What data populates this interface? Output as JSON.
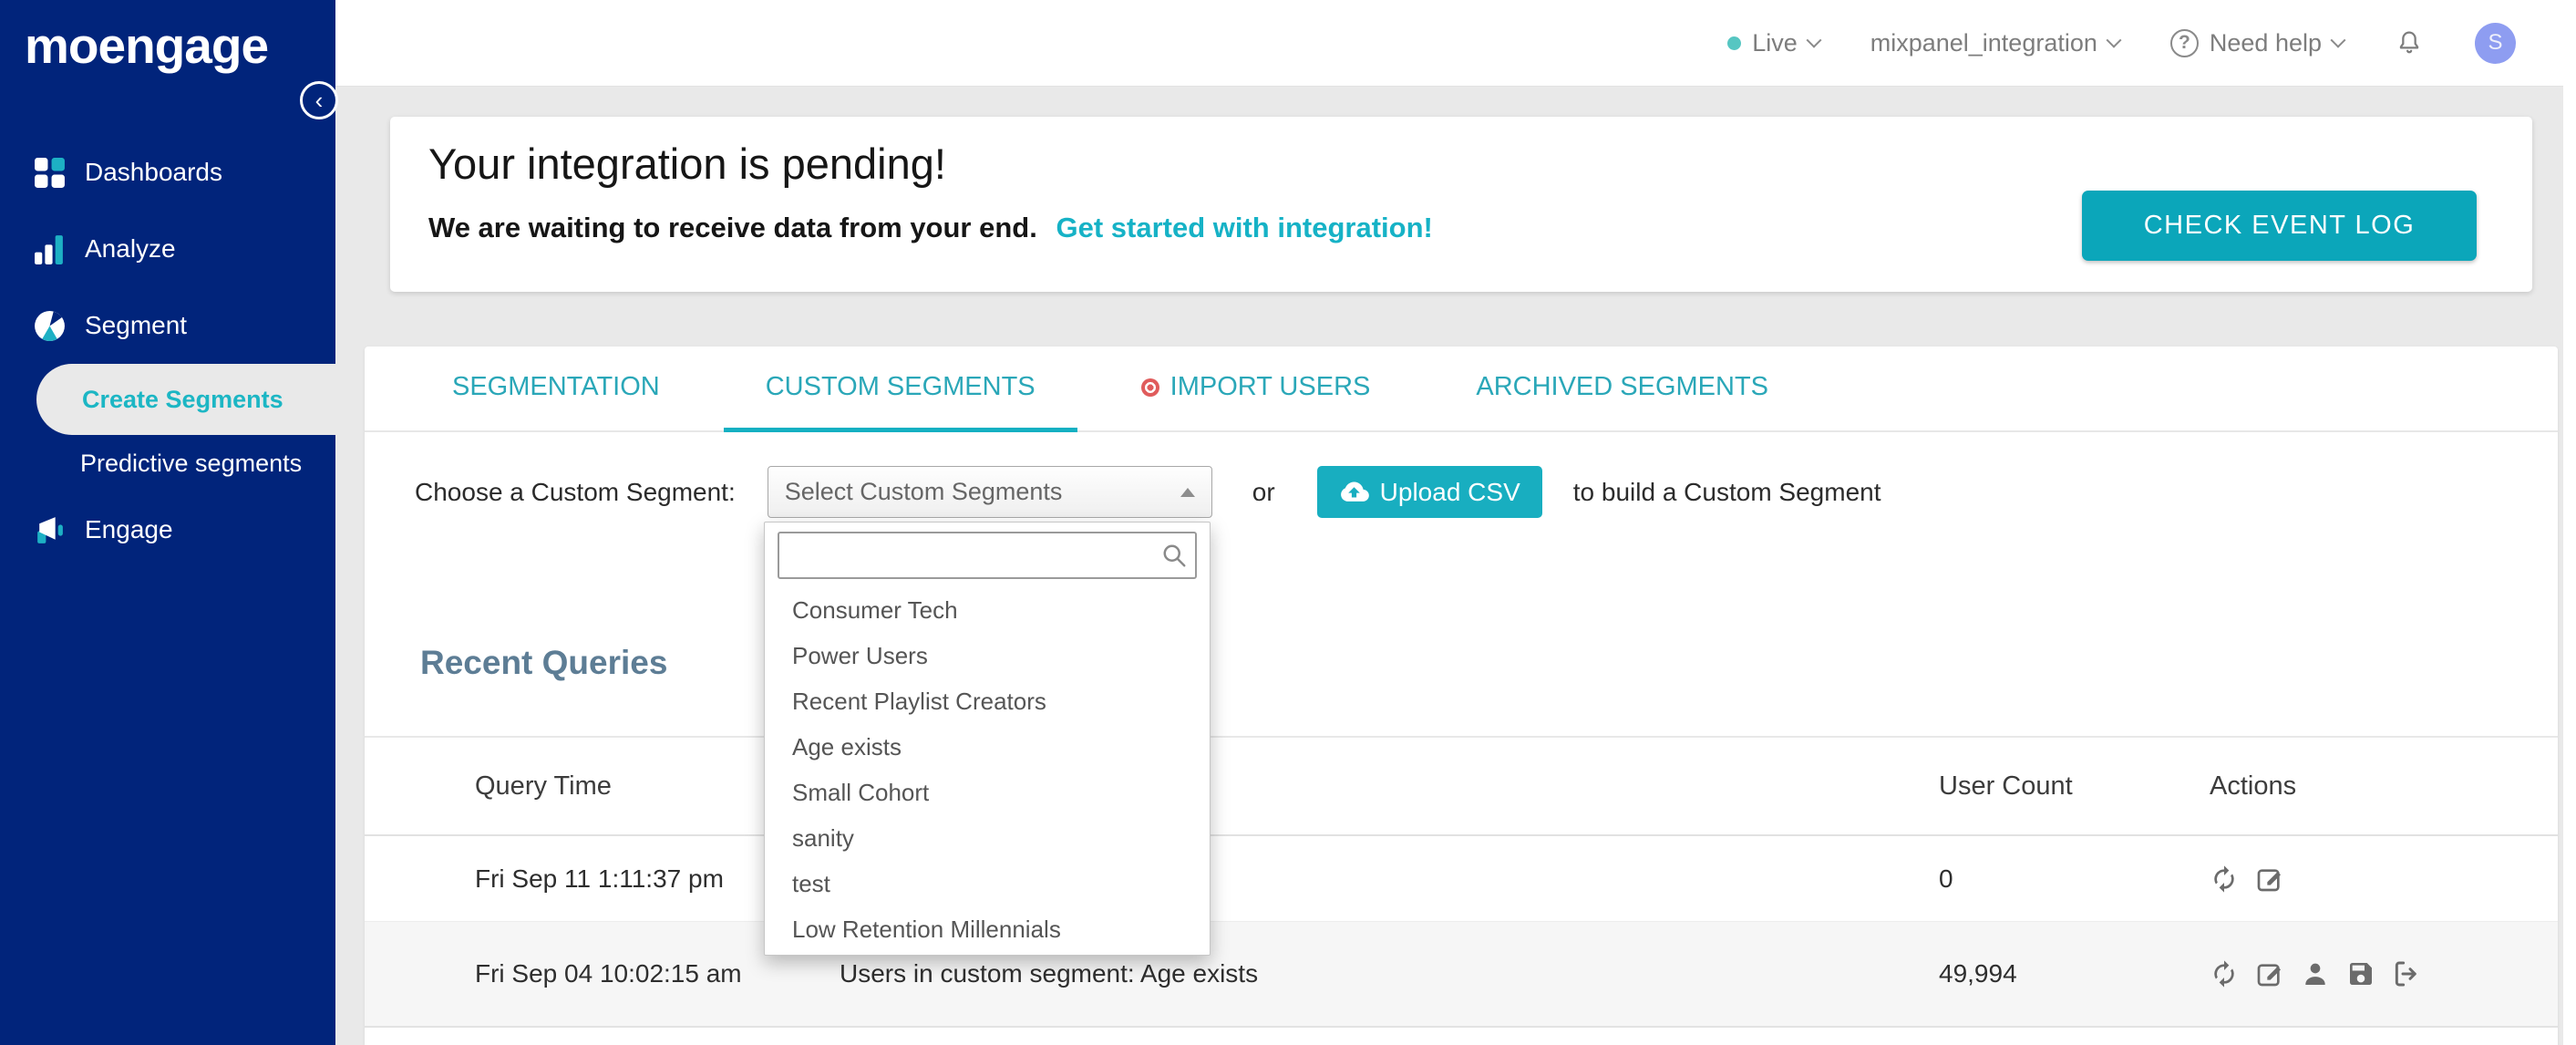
{
  "sidebar": {
    "logo": "moengage",
    "items": [
      {
        "label": "Dashboards",
        "icon": "dashboards-icon"
      },
      {
        "label": "Analyze",
        "icon": "analyze-icon"
      },
      {
        "label": "Segment",
        "icon": "segment-icon"
      },
      {
        "label": "Create Segments",
        "sub": true,
        "active": true
      },
      {
        "label": "Predictive segments",
        "sub": true
      },
      {
        "label": "Engage",
        "icon": "engage-icon"
      }
    ]
  },
  "header": {
    "env_label": "Live",
    "app_name": "mixpanel_integration",
    "help_label": "Need help",
    "avatar_initial": "S"
  },
  "banner": {
    "title": "Your integration is pending!",
    "message": "We are waiting to receive data from your end.",
    "link": "Get started with integration!",
    "button": "CHECK EVENT LOG"
  },
  "tabs": [
    {
      "label": "SEGMENTATION"
    },
    {
      "label": "CUSTOM SEGMENTS",
      "active": true
    },
    {
      "label": "IMPORT USERS",
      "dot": true
    },
    {
      "label": "ARCHIVED SEGMENTS"
    }
  ],
  "chooser": {
    "label": "Choose a Custom Segment:",
    "select_value": "Select Custom Segments",
    "search_value": "",
    "or": "or",
    "upload_button": "Upload CSV",
    "suffix": "to build a Custom Segment",
    "options": [
      "Consumer Tech",
      "Power Users",
      "Recent Playlist Creators",
      "Age exists",
      "Small Cohort",
      "sanity",
      "test",
      "Low Retention Millennials"
    ]
  },
  "recent": {
    "title": "Recent Queries",
    "columns": [
      "Query Time",
      "User Count",
      "Actions"
    ],
    "rows": [
      {
        "time": "Fri Sep 11 1:11:37 pm",
        "desc": "",
        "count": "0",
        "actions": [
          "refresh-icon",
          "edit-icon"
        ]
      },
      {
        "time": "Fri Sep 04 10:02:15 am",
        "desc": "Users in custom segment: Age exists",
        "count": "49,994",
        "actions": [
          "refresh-icon",
          "edit-icon",
          "user-icon",
          "save-icon",
          "export-icon"
        ]
      }
    ]
  },
  "colors": {
    "sidebar_navy": "#01247b",
    "accent_teal": "#14b0c2",
    "button_teal": "#0ba6ba",
    "link_teal": "#16b2c6",
    "live_dot": "#56c6c2",
    "import_dot": "#e05c5c",
    "heading_slate": "#5d7d95",
    "avatar_bg": "#8e9df1",
    "page_bg": "#e9e9e9"
  }
}
